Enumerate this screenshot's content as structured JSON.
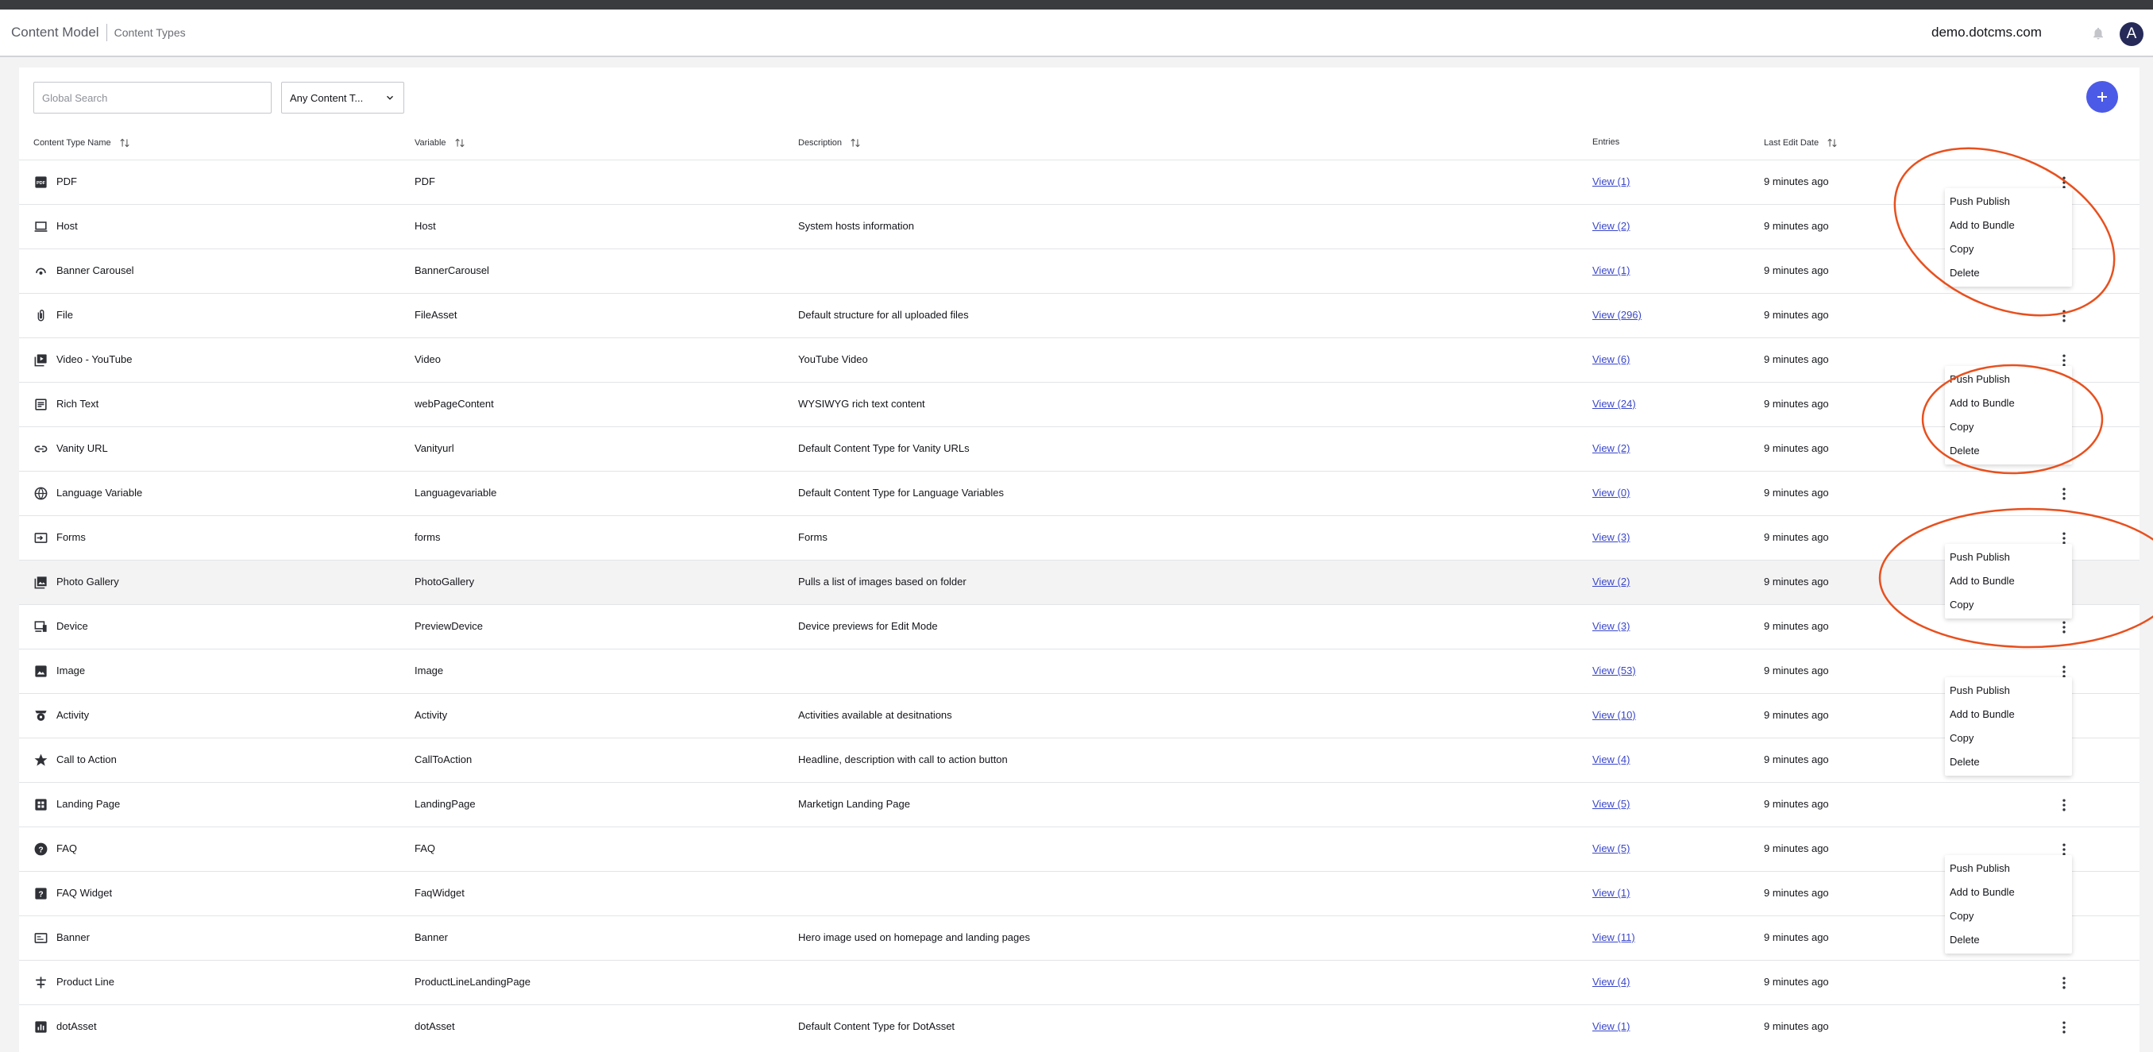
{
  "header": {
    "title": "Content Model",
    "subtitle": "Content Types",
    "site": "demo.dotcms.com",
    "avatar_letter": "A"
  },
  "toolbar": {
    "search_placeholder": "Global Search",
    "filter_value": "Any Content T..."
  },
  "table": {
    "columns": [
      "Content Type Name",
      "Variable",
      "Description",
      "Entries",
      "Last Edit Date"
    ],
    "rows": [
      {
        "icon": "pdf-icon",
        "name": "PDF",
        "variable": "PDF",
        "description": "",
        "entries": "View (1)",
        "date": "9 minutes ago"
      },
      {
        "icon": "laptop-icon",
        "name": "Host",
        "variable": "Host",
        "description": "System hosts information",
        "entries": "View (2)",
        "date": "9 minutes ago"
      },
      {
        "icon": "carousel-icon",
        "name": "Banner Carousel",
        "variable": "BannerCarousel",
        "description": "",
        "entries": "View (1)",
        "date": "9 minutes ago"
      },
      {
        "icon": "attachment-icon",
        "name": "File",
        "variable": "FileAsset",
        "description": "Default structure for all uploaded files",
        "entries": "View (296)",
        "date": "9 minutes ago"
      },
      {
        "icon": "video-icon",
        "name": "Video - YouTube",
        "variable": "Video",
        "description": "YouTube Video",
        "entries": "View (6)",
        "date": "9 minutes ago"
      },
      {
        "icon": "rich-text-icon",
        "name": "Rich Text",
        "variable": "webPageContent",
        "description": "WYSIWYG rich text content",
        "entries": "View (24)",
        "date": "9 minutes ago"
      },
      {
        "icon": "link-icon",
        "name": "Vanity URL",
        "variable": "Vanityurl",
        "description": "Default Content Type for Vanity URLs",
        "entries": "View (2)",
        "date": "9 minutes ago"
      },
      {
        "icon": "globe-icon",
        "name": "Language Variable",
        "variable": "Languagevariable",
        "description": "Default Content Type for Language Variables",
        "entries": "View (0)",
        "date": "9 minutes ago"
      },
      {
        "icon": "form-icon",
        "name": "Forms",
        "variable": "forms",
        "description": "Forms",
        "entries": "View (3)",
        "date": "9 minutes ago"
      },
      {
        "icon": "photo-gallery-icon",
        "name": "Photo Gallery",
        "variable": "PhotoGallery",
        "description": "Pulls a list of images based on folder",
        "entries": "View (2)",
        "date": "9 minutes ago"
      },
      {
        "icon": "devices-icon",
        "name": "Device",
        "variable": "PreviewDevice",
        "description": "Device previews for Edit Mode",
        "entries": "View (3)",
        "date": "9 minutes ago"
      },
      {
        "icon": "image-icon",
        "name": "Image",
        "variable": "Image",
        "description": "",
        "entries": "View (53)",
        "date": "9 minutes ago"
      },
      {
        "icon": "activity-icon",
        "name": "Activity",
        "variable": "Activity",
        "description": "Activities available at desitnations",
        "entries": "View (10)",
        "date": "9 minutes ago"
      },
      {
        "icon": "star-icon",
        "name": "Call to Action",
        "variable": "CallToAction",
        "description": "Headline, description with call to action button",
        "entries": "View (4)",
        "date": "9 minutes ago"
      },
      {
        "icon": "landing-page-icon",
        "name": "Landing Page",
        "variable": "LandingPage",
        "description": "Marketign Landing Page",
        "entries": "View (5)",
        "date": "9 minutes ago"
      },
      {
        "icon": "help-circle-icon",
        "name": "FAQ",
        "variable": "FAQ",
        "description": "",
        "entries": "View (5)",
        "date": "9 minutes ago"
      },
      {
        "icon": "help-square-icon",
        "name": "FAQ Widget",
        "variable": "FaqWidget",
        "description": "",
        "entries": "View (1)",
        "date": "9 minutes ago"
      },
      {
        "icon": "banner-icon",
        "name": "Banner",
        "variable": "Banner",
        "description": "Hero image used on homepage and landing pages",
        "entries": "View (11)",
        "date": "9 minutes ago"
      },
      {
        "icon": "product-line-icon",
        "name": "Product Line",
        "variable": "ProductLineLandingPage",
        "description": "",
        "entries": "View (4)",
        "date": "9 minutes ago"
      },
      {
        "icon": "dot-asset-icon",
        "name": "dotAsset",
        "variable": "dotAsset",
        "description": "Default Content Type for DotAsset",
        "entries": "View (1)",
        "date": "9 minutes ago"
      }
    ]
  },
  "menus": [
    {
      "items": [
        "Push Publish",
        "Add to Bundle",
        "Copy",
        "Delete"
      ]
    },
    {
      "items": [
        "Push Publish",
        "Add to Bundle",
        "Copy",
        "Delete"
      ]
    },
    {
      "items": [
        "Push Publish",
        "Add to Bundle",
        "Copy"
      ]
    },
    {
      "items": [
        "Push Publish",
        "Add to Bundle",
        "Copy",
        "Delete"
      ]
    },
    {
      "items": [
        "Push Publish",
        "Add to Bundle",
        "Copy",
        "Delete"
      ]
    }
  ],
  "colors": {
    "accent": "#4c5ae8",
    "link": "#3a47c9",
    "annotation": "#e8501e"
  }
}
